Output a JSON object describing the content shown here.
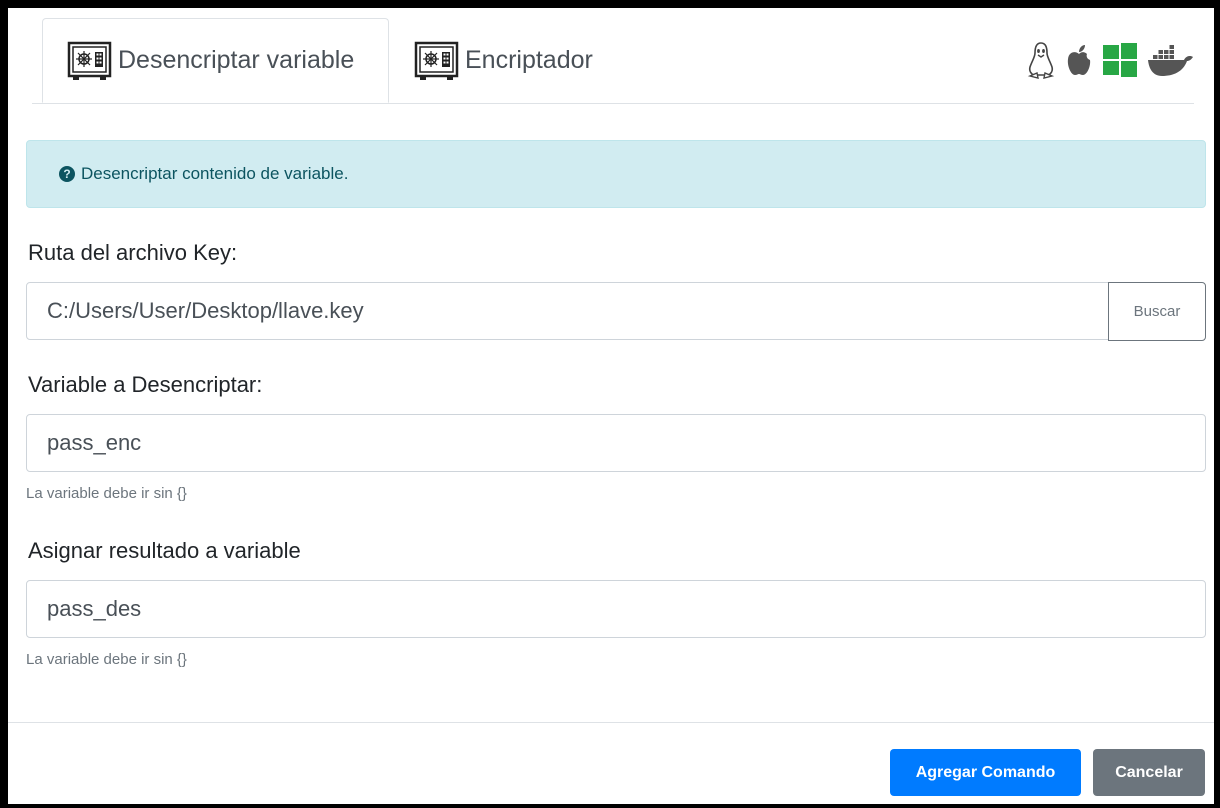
{
  "tabs": [
    {
      "label": "Desencriptar variable",
      "icon": "safe-icon",
      "active": true
    },
    {
      "label": "Encriptador",
      "icon": "safe-icon",
      "active": false
    }
  ],
  "platforms": [
    "linux-icon",
    "apple-icon",
    "windows-icon",
    "docker-icon"
  ],
  "alert": {
    "text": "Desencriptar contenido de variable.",
    "icon": "question-circle-icon"
  },
  "key_path": {
    "label": "Ruta del archivo Key:",
    "value": "C:/Users/User/Desktop/llave.key",
    "browse_label": "Buscar"
  },
  "variable": {
    "label": "Variable a Desencriptar:",
    "value": "pass_enc",
    "help": "La variable debe ir sin {}"
  },
  "result": {
    "label": "Asignar resultado a variable",
    "value": "pass_des",
    "help": "La variable debe ir sin {}"
  },
  "actions": {
    "add_label": "Agregar Comando",
    "cancel_label": "Cancelar"
  },
  "colors": {
    "primary": "#007bff",
    "secondary": "#6c757d",
    "alert_bg": "#d1ecf1",
    "windows": "#28a745"
  }
}
